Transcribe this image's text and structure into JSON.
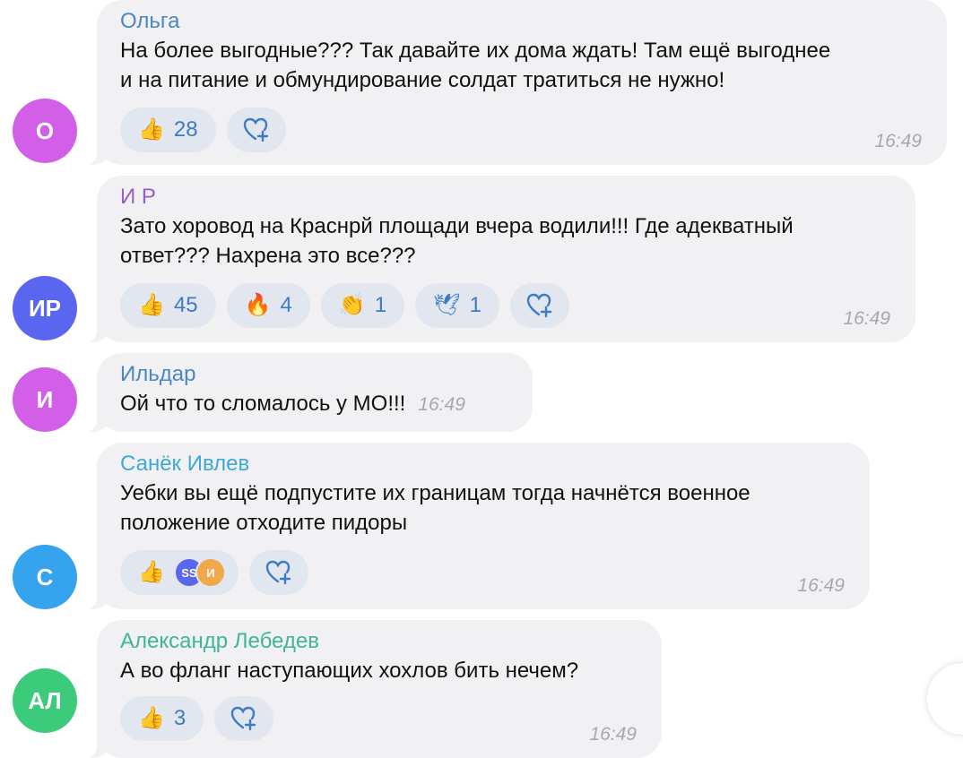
{
  "messages": [
    {
      "author": "Ольга",
      "author_color": "#4a86c8",
      "avatar_letters": "О",
      "avatar_color": "#d35ee7",
      "text_lines": [
        "На более выгодные??? Так давайте их дома ждать! Там ещё выгоднее",
        "и на питание и обмундирование солдат тратиться не нужно!"
      ],
      "reactions": [
        {
          "emoji": "👍",
          "count": "28"
        }
      ],
      "time": "16:49"
    },
    {
      "author": "И Р",
      "author_color": "#9a5cc8",
      "avatar_letters": "ИР",
      "avatar_color": "#5a66ef",
      "text_lines": [
        "Зато хоровод на Краснрй площади вчера водили!!! Где адекватный",
        "ответ??? Нахрена это все???"
      ],
      "reactions": [
        {
          "emoji": "👍",
          "count": "45"
        },
        {
          "emoji": "🔥",
          "count": "4"
        },
        {
          "emoji": "👏",
          "count": "1"
        },
        {
          "emoji": "🕊",
          "count": "1"
        }
      ],
      "time": "16:49"
    },
    {
      "author": "Ильдар",
      "author_color": "#4a86c8",
      "avatar_letters": "И",
      "avatar_color": "#d35ee7",
      "text_lines": [
        "Ой что то сломалось у МО!!!"
      ],
      "time": "16:49"
    },
    {
      "author": "Санёк Ивлев",
      "author_color": "#3fa8d8",
      "avatar_letters": "С",
      "avatar_color": "#36a3ee",
      "text_lines": [
        "Уебки вы ещё подпустите их границам тогда начнётся военное",
        "положение отходите пидоры"
      ],
      "reactions": [
        {
          "emoji": "👍",
          "mini": [
            "SS",
            "И"
          ]
        }
      ],
      "mini_colors": [
        "#5a66ef",
        "#f0a84a"
      ],
      "time": "16:49"
    },
    {
      "author": "Александр Лебедев",
      "author_color": "#3fb59a",
      "avatar_letters": "АЛ",
      "avatar_color": "#3ccb7a",
      "text_lines": [
        "А во фланг наступающих хохлов бить нечем?"
      ],
      "reactions": [
        {
          "emoji": "👍",
          "count": "3"
        }
      ],
      "time": "16:49"
    }
  ],
  "icons": {
    "add_reaction": "heart-plus-icon",
    "thumbs_up": "thumbs-up-icon"
  }
}
